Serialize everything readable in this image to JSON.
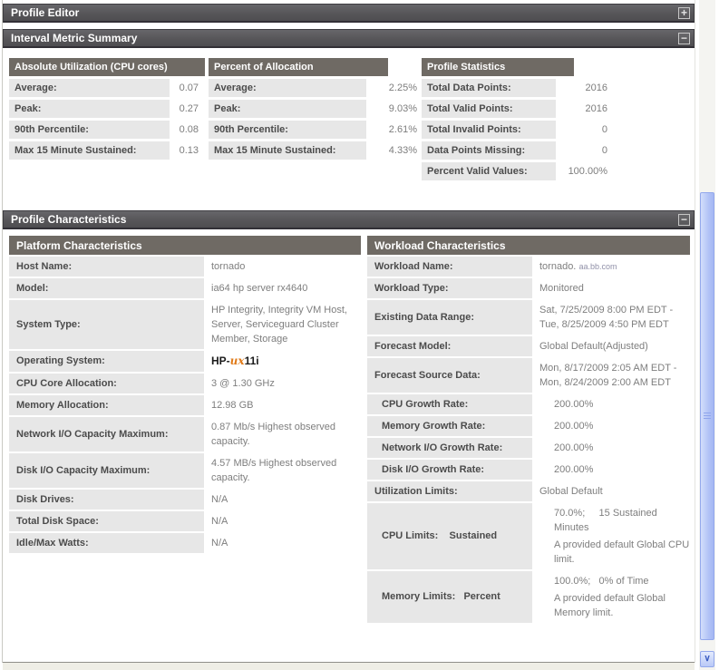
{
  "colors": {
    "section_header_bg": "#575659",
    "table_header_bg": "#6f6a64",
    "label_cell_bg": "#e7e7e7",
    "value_text": "#7e7e7e",
    "scroll_thumb": "#b2c3f6",
    "hpux_orange": "#e07b1a"
  },
  "scrollbar": {
    "down_arrow": "∨"
  },
  "profile_editor": {
    "title": "Profile Editor",
    "toggle": "+"
  },
  "interval": {
    "title": "Interval Metric Summary",
    "toggle": "−",
    "absolute": {
      "header": "Absolute Utilization (CPU cores)",
      "rows": [
        {
          "label": "Average:",
          "value": "0.07"
        },
        {
          "label": "Peak:",
          "value": "0.27"
        },
        {
          "label": "90th Percentile:",
          "value": "0.08"
        },
        {
          "label": "Max 15 Minute Sustained:",
          "value": "0.13"
        }
      ]
    },
    "percent": {
      "header": "Percent of Allocation",
      "rows": [
        {
          "label": "Average:",
          "value": "2.25%"
        },
        {
          "label": "Peak:",
          "value": "9.03%"
        },
        {
          "label": "90th Percentile:",
          "value": "2.61%"
        },
        {
          "label": "Max 15 Minute Sustained:",
          "value": "4.33%"
        }
      ]
    },
    "stats": {
      "header": "Profile Statistics",
      "rows": [
        {
          "label": "Total Data Points:",
          "value": "2016"
        },
        {
          "label": "Total Valid Points:",
          "value": "2016"
        },
        {
          "label": "Total Invalid Points:",
          "value": "0"
        },
        {
          "label": "Data Points Missing:",
          "value": "0"
        },
        {
          "label": "Percent Valid Values:",
          "value": "100.00%"
        }
      ]
    }
  },
  "characteristics": {
    "title": "Profile Characteristics",
    "toggle": "−",
    "platform": {
      "header": "Platform Characteristics",
      "os_logo": {
        "prefix": "HP-",
        "ux": "ux",
        "suffix": "11i"
      },
      "rows": [
        {
          "label": "Host Name:",
          "value": "tornado"
        },
        {
          "label": "Model:",
          "value": "ia64 hp server rx4640"
        },
        {
          "label": "System Type:",
          "value": "HP Integrity, Integrity VM Host, Server, Serviceguard Cluster Member, Storage"
        },
        {
          "label": "Operating System:",
          "value": ""
        },
        {
          "label": "CPU Core Allocation:",
          "value": "3 @ 1.30 GHz"
        },
        {
          "label": "Memory Allocation:",
          "value": "12.98 GB"
        },
        {
          "label": "Network I/O Capacity Maximum:",
          "value": "0.87 Mb/s Highest observed capacity."
        },
        {
          "label": "Disk I/O Capacity Maximum:",
          "value": "4.57 MB/s Highest observed capacity."
        },
        {
          "label": "Disk Drives:",
          "value": "N/A"
        },
        {
          "label": "Total Disk Space:",
          "value": "N/A"
        },
        {
          "label": "Idle/Max Watts:",
          "value": "N/A"
        }
      ]
    },
    "workload": {
      "header": "Workload Characteristics",
      "rows": [
        {
          "label": "Workload Name:",
          "value": "tornado.",
          "domain": "aa.bb.com"
        },
        {
          "label": "Workload Type:",
          "value": "Monitored"
        },
        {
          "label": "Existing Data Range:",
          "value": "Sat, 7/25/2009 8:00 PM EDT - Tue, 8/25/2009 4:50 PM EDT"
        },
        {
          "label": "Forecast Model:",
          "value": "Global Default(Adjusted)"
        },
        {
          "label": "Forecast Source Data:",
          "value": "Mon, 8/17/2009 2:05 AM EDT - Mon, 8/24/2009 2:00 AM EDT"
        },
        {
          "label": "CPU Growth Rate:",
          "value": "200.00%"
        },
        {
          "label": "Memory Growth Rate:",
          "value": "200.00%"
        },
        {
          "label": "Network I/O Growth Rate:",
          "value": "200.00%"
        },
        {
          "label": "Disk I/O Growth Rate:",
          "value": "200.00%"
        },
        {
          "label": "Utilization Limits:",
          "value": "Global Default"
        },
        {
          "label": "CPU Limits:    Sustained",
          "value_line1": "70.0%;     15 Sustained Minutes",
          "value_line2": "A provided default Global CPU limit."
        },
        {
          "label": "Memory Limits:   Percent",
          "value_line1": "100.0%;   0% of Time",
          "value_line2": "A provided default Global Memory limit."
        }
      ]
    }
  }
}
